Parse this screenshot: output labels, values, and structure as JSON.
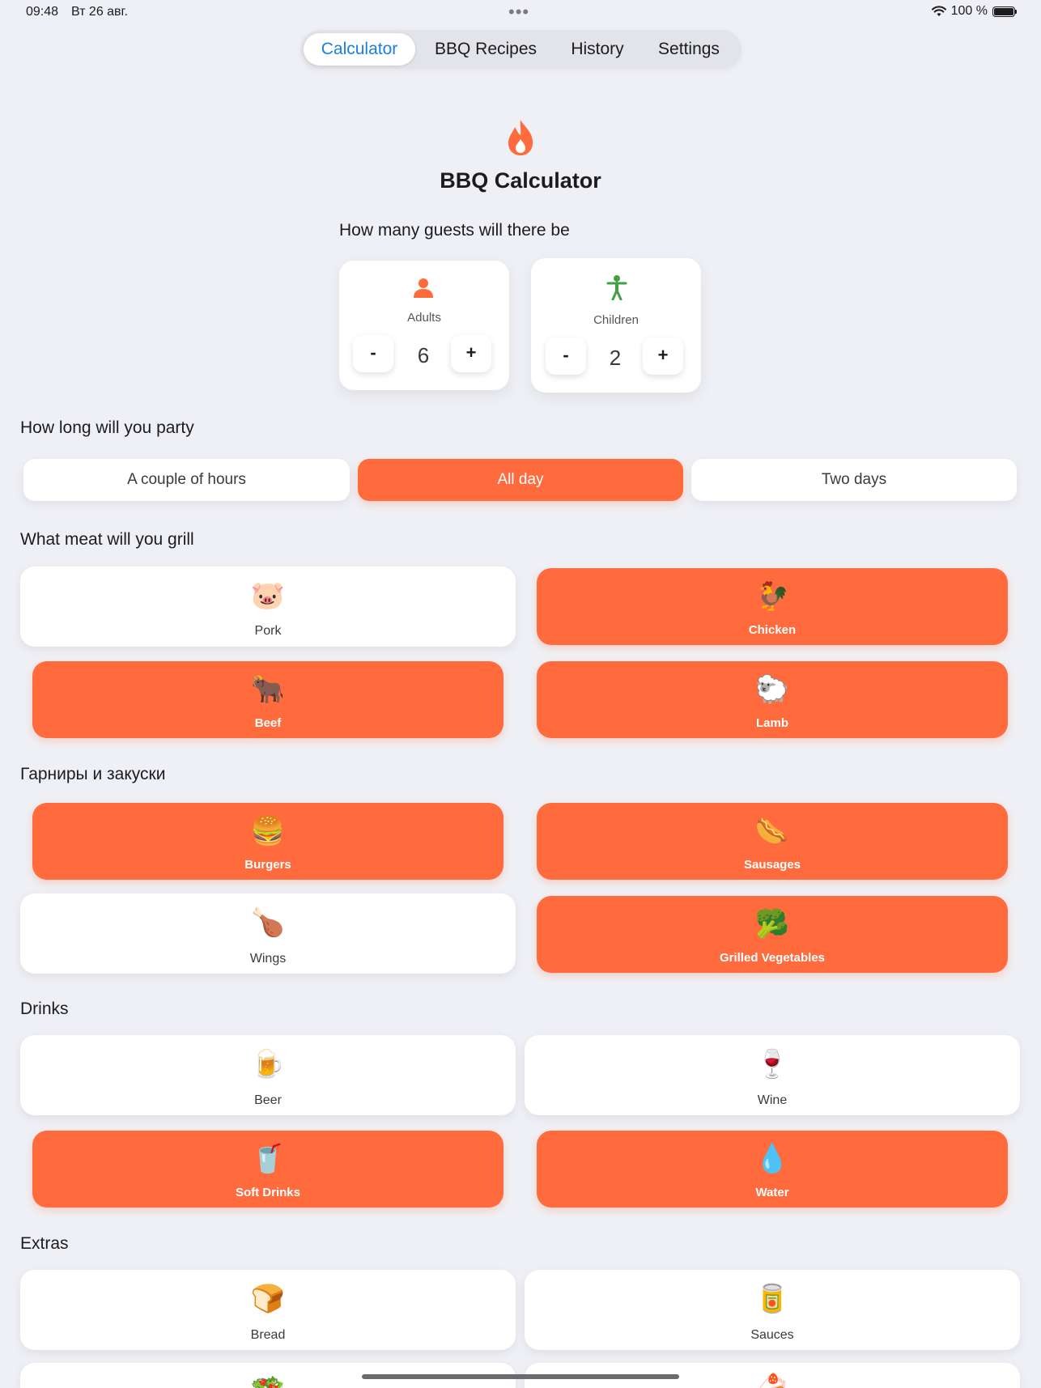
{
  "status_bar": {
    "time": "09:48",
    "date": "Вт 26 авг.",
    "battery": "100 %"
  },
  "tabs": [
    {
      "label": "Calculator",
      "active": true
    },
    {
      "label": "BBQ Recipes",
      "active": false
    },
    {
      "label": "History",
      "active": false
    },
    {
      "label": "Settings",
      "active": false
    }
  ],
  "header": {
    "title": "BBQ Calculator",
    "icon": "flame-icon",
    "accent": "#ff6b3d"
  },
  "guests": {
    "question": "How many guests will there be",
    "adults": {
      "label": "Adults",
      "value": "6",
      "minus": "-",
      "plus": "+"
    },
    "children": {
      "label": "Children",
      "value": "2",
      "minus": "-",
      "plus": "+"
    }
  },
  "duration": {
    "question": "How long will you party",
    "options": [
      {
        "label": "A couple of hours",
        "selected": false
      },
      {
        "label": "All day",
        "selected": true
      },
      {
        "label": "Two days",
        "selected": false
      }
    ]
  },
  "meat": {
    "title": "What meat will you grill",
    "items": [
      {
        "label": "Pork",
        "emoji": "🐷",
        "selected": false
      },
      {
        "label": "Chicken",
        "emoji": "🐓",
        "selected": true
      },
      {
        "label": "Beef",
        "emoji": "🐂",
        "selected": true
      },
      {
        "label": "Lamb",
        "emoji": "🐑",
        "selected": true
      }
    ]
  },
  "sides": {
    "title": "Гарниры и закуски",
    "items": [
      {
        "label": "Burgers",
        "emoji": "🍔",
        "selected": true
      },
      {
        "label": "Sausages",
        "emoji": "🌭",
        "selected": true
      },
      {
        "label": "Wings",
        "emoji": "🍗",
        "selected": false
      },
      {
        "label": "Grilled Vegetables",
        "emoji": "🥦",
        "selected": true
      }
    ]
  },
  "drinks": {
    "title": "Drinks",
    "items": [
      {
        "label": "Beer",
        "emoji": "🍺",
        "selected": false
      },
      {
        "label": "Wine",
        "emoji": "🍷",
        "selected": false
      },
      {
        "label": "Soft Drinks",
        "emoji": "🥤",
        "selected": true
      },
      {
        "label": "Water",
        "emoji": "💧",
        "selected": true
      }
    ]
  },
  "extras": {
    "title": "Extras",
    "items": [
      {
        "label": "Bread",
        "emoji": "🍞",
        "selected": false
      },
      {
        "label": "Sauces",
        "emoji": "🥫",
        "selected": false
      },
      {
        "label": "",
        "emoji": "🥗",
        "selected": false
      },
      {
        "label": "",
        "emoji": "🍰",
        "selected": false
      }
    ]
  }
}
